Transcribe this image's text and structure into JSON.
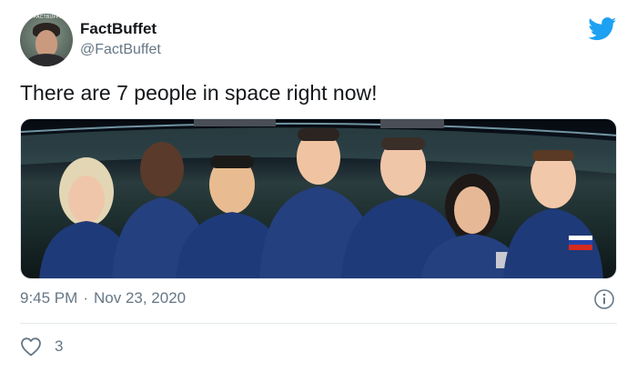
{
  "author": {
    "name": "FactBuffet",
    "handle": "@FactBuffet",
    "avatar_badge": "FACTBUFFET"
  },
  "tweet": {
    "text": "There are 7 people in space right now!",
    "time": "9:45 PM",
    "separator": "·",
    "date": "Nov 23, 2020"
  },
  "engagement": {
    "likes": "3"
  },
  "icons": {
    "brand": "twitter-bird-icon",
    "info": "info-icon",
    "like": "heart-icon"
  },
  "colors": {
    "brand": "#1da1f2",
    "text": "#14171a",
    "secondary": "#657786",
    "divider": "#e1e8ed"
  }
}
